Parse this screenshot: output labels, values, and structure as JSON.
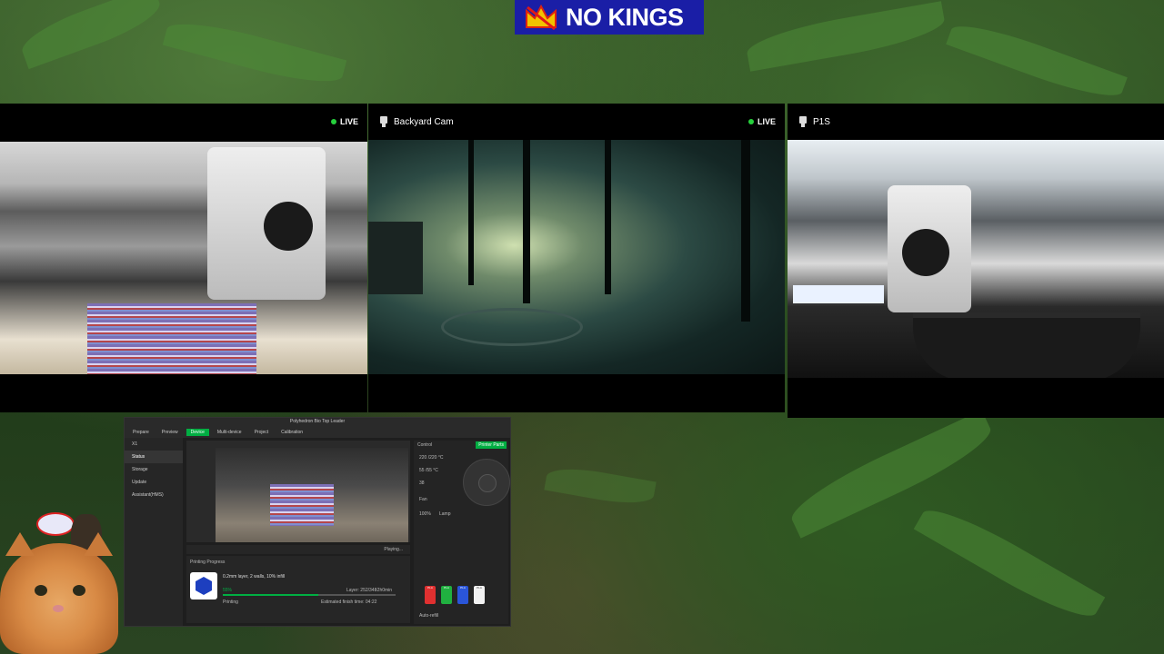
{
  "banner": {
    "text": "NO KINGS"
  },
  "cameras": [
    {
      "title": "",
      "live": "LIVE"
    },
    {
      "title": "Backyard Cam",
      "live": "LIVE"
    },
    {
      "title": "P1S",
      "live": ""
    }
  ],
  "studio": {
    "tabs": [
      "Prepare",
      "Preview",
      "Device",
      "Multi-device",
      "Project",
      "Calibration"
    ],
    "active_tab": "Device",
    "title": "Polyhedron Bio Top Leader",
    "sidebar": {
      "printer": "X1",
      "items": [
        "Status",
        "Storage",
        "Update",
        "Assistant(HMS)"
      ]
    },
    "video_status": "Playing...",
    "printing_progress_label": "Printing Progress",
    "job": "0.2mm layer, 2 walls, 10% infill",
    "percent": "55%",
    "layer": "Layer: 252/348",
    "remaining": "-2h0min",
    "state": "Printing",
    "finish": "Estimated finish time: 04:22",
    "progress_value": 0.55,
    "control_label": "Control",
    "printer_parts": "Printer Parts",
    "nozzle_temp": "220",
    "nozzle_target": "/220 °C",
    "bed_temp": "55",
    "bed_target": "/55 °C",
    "chamber_temp": "38",
    "fan_label": "Fan",
    "speed": "100%",
    "lamp": "Lamp",
    "ams_label": "Auto-refill",
    "spools": [
      {
        "label": "PLA",
        "color": "#e03030"
      },
      {
        "label": "PLA",
        "color": "#20b040"
      },
      {
        "label": "PLA",
        "color": "#2a55d8"
      },
      {
        "label": "PLA",
        "color": "#f2f2f2"
      }
    ]
  }
}
